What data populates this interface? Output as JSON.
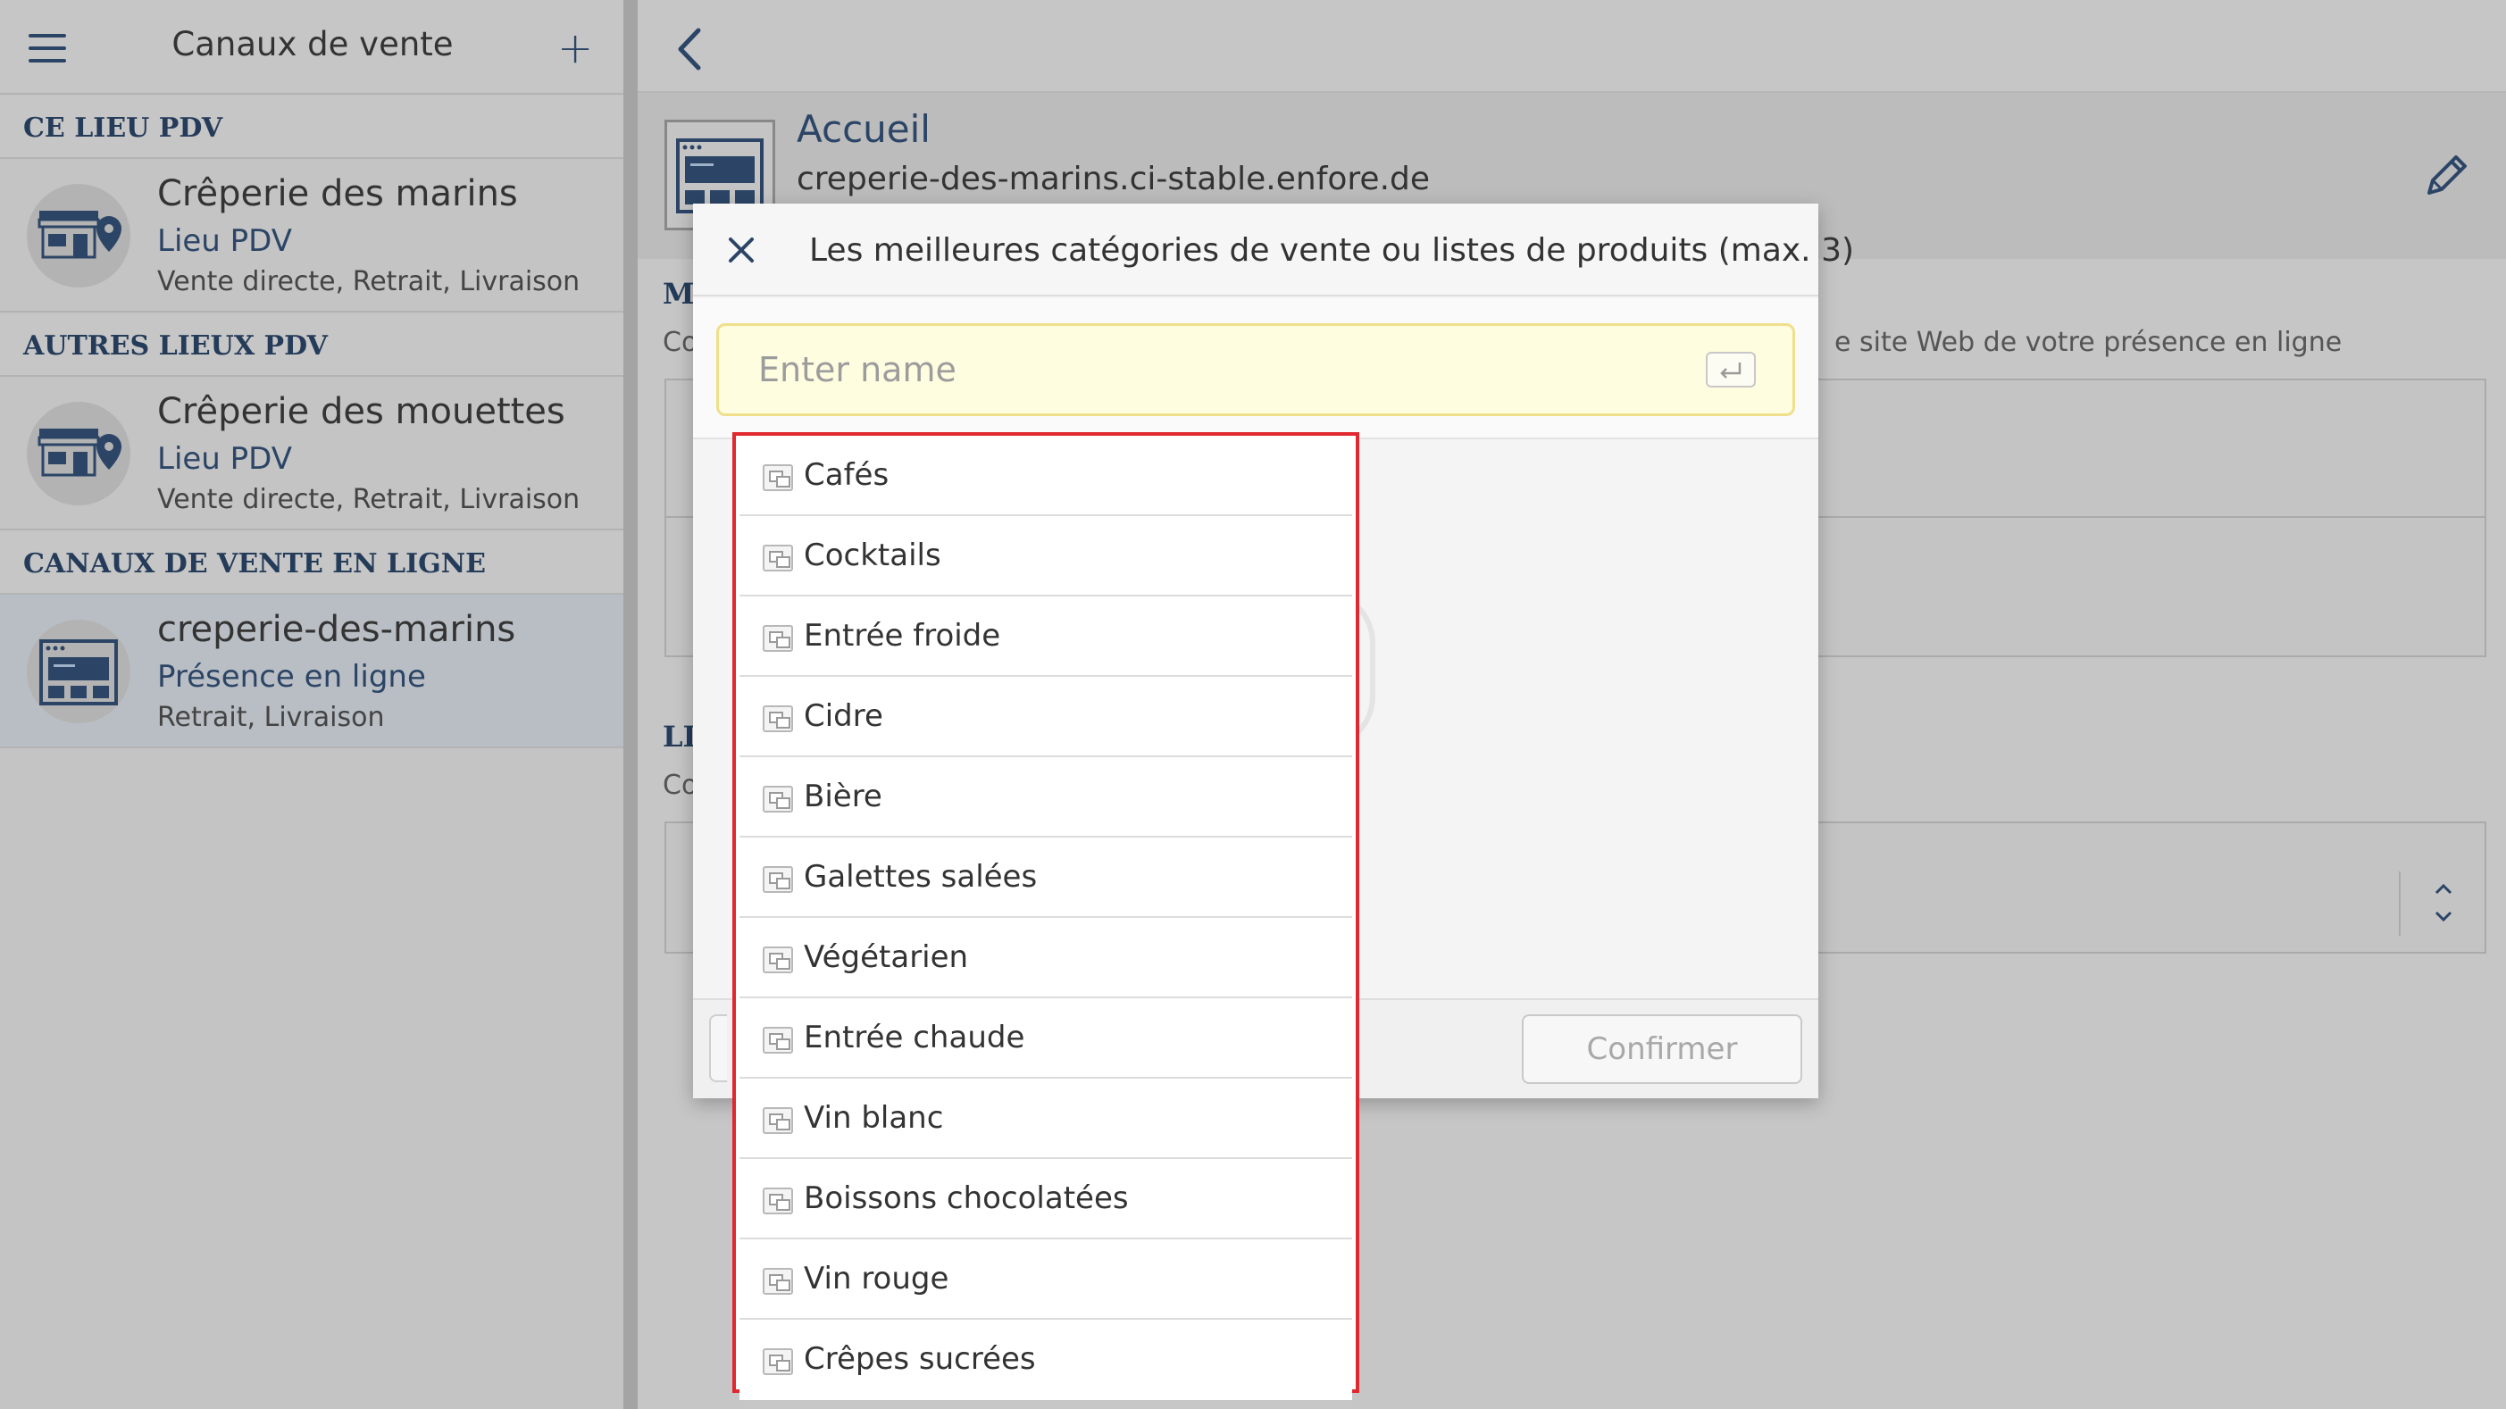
{
  "sidebar": {
    "title": "Canaux de vente",
    "menu_icon": "hamburger-menu-icon",
    "add_icon": "plus-icon",
    "sections": [
      {
        "heading": "CE LIEU PDV",
        "items": [
          {
            "name": "Crêperie des marins",
            "type": "Lieu PDV",
            "desc": "Vente directe, Retrait, Livraison",
            "icon": "store-location-icon"
          }
        ]
      },
      {
        "heading": "AUTRES LIEUX PDV",
        "items": [
          {
            "name": "Crêperie des mouettes",
            "type": "Lieu PDV",
            "desc": "Vente directe, Retrait, Livraison",
            "icon": "store-location-icon"
          }
        ]
      },
      {
        "heading": "CANAUX DE VENTE EN LIGNE",
        "items": [
          {
            "name": "creperie-des-marins",
            "type": "Présence en ligne",
            "desc": "Retrait, Livraison",
            "icon": "website-icon",
            "selected": true
          }
        ]
      }
    ]
  },
  "main": {
    "back_icon": "chevron-left-icon",
    "detail": {
      "title": "Accueil",
      "url": "creperie-des-marins.ci-stable.enfore.de",
      "icon": "website-icon",
      "edit_icon": "pencil-icon"
    },
    "background": {
      "section1_label": "M",
      "section1_sub": "Co",
      "help_text": "e site Web de votre présence en ligne",
      "section2_label": "LI",
      "section2_sub": "Co"
    }
  },
  "modal": {
    "title": "Les meilleures catégories de vente ou listes de produits (max. 3)",
    "close_icon": "close-icon",
    "search": {
      "placeholder": "Enter name",
      "value": ""
    },
    "enter_icon": "enter-key-icon",
    "confirm_label": "Confirmer"
  },
  "dropdown": {
    "item_icon": "product-list-icon",
    "items": [
      "Cafés",
      "Cocktails",
      "Entrée froide",
      "Cidre",
      "Bière",
      "Galettes salées",
      "Végétarien",
      "Entrée chaude",
      "Vin blanc",
      "Boissons chocolatées",
      "Vin rouge",
      "Crêpes sucrées"
    ]
  },
  "colors": {
    "accent": "#2c4566",
    "highlight_border": "#e0282e",
    "input_bg": "#fffde0"
  }
}
